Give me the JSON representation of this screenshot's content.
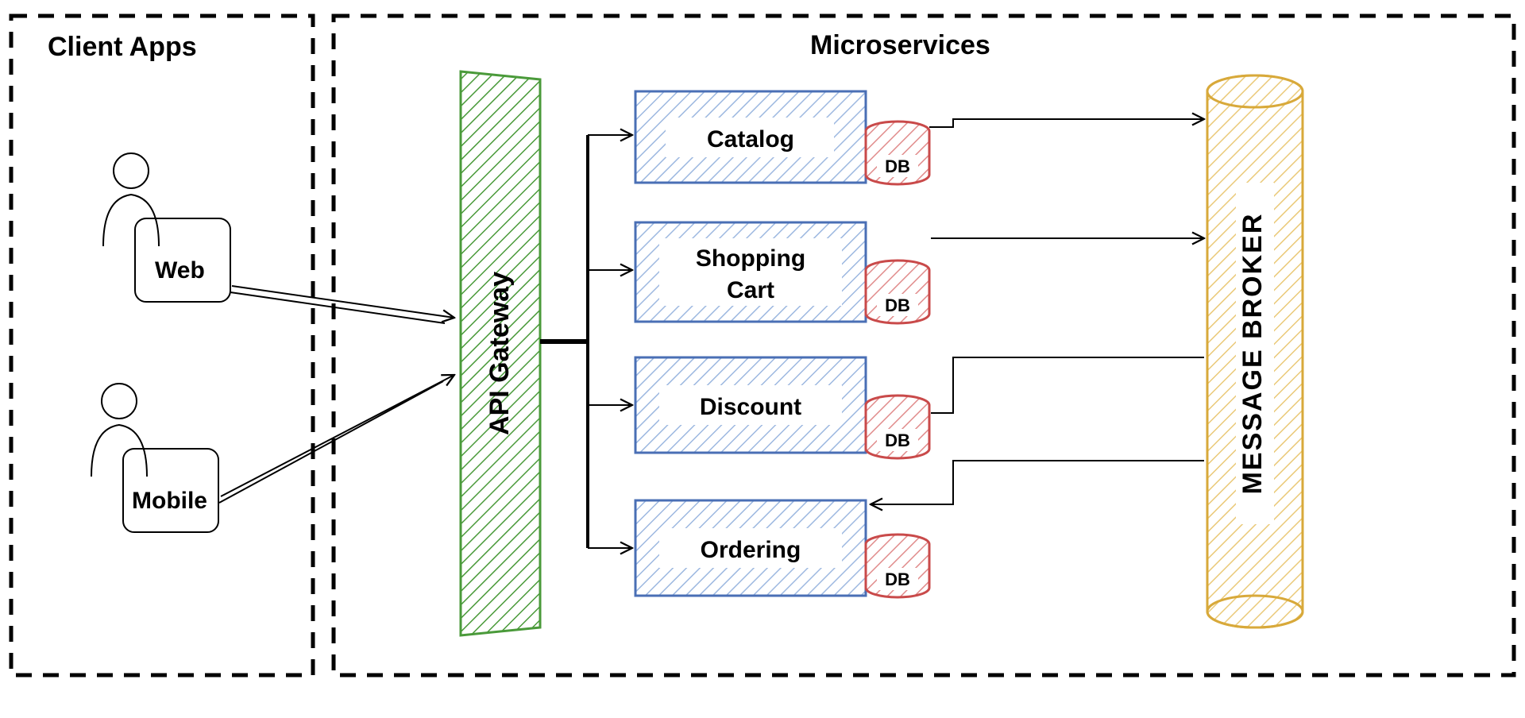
{
  "clientApps": {
    "title": "Client Apps",
    "web": "Web",
    "mobile": "Mobile"
  },
  "microservices": {
    "title": "Microservices",
    "gateway": "API Gateway",
    "services": [
      {
        "name": "Catalog",
        "db": "DB"
      },
      {
        "name": "Shopping Cart",
        "db": "DB"
      },
      {
        "name": "Discount",
        "db": "DB"
      },
      {
        "name": "Ordering",
        "db": "DB"
      }
    ],
    "broker": "MESSAGE BROKER"
  },
  "colors": {
    "gateway": "#4a9a3a",
    "service": "#4a6fb5",
    "db": "#c94a4a",
    "broker": "#d8a93a"
  }
}
